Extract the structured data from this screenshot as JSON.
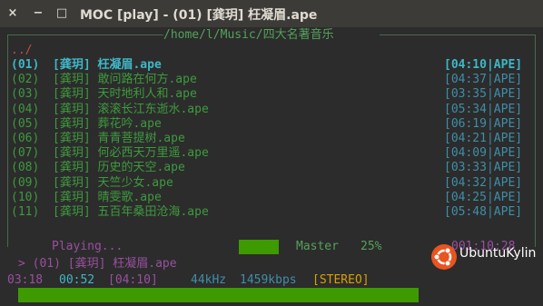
{
  "window": {
    "title": "MOC [play] - (01) [龚玥] 枉凝眉.ape",
    "close_glyph": "×",
    "minimize_glyph": "−",
    "maximize_glyph": "□"
  },
  "playlist": {
    "path": "/home/l/Music/四大名著音乐",
    "up_dir": "../",
    "tracks": [
      {
        "num": "(01)",
        "name": "[龚玥] 枉凝眉.ape",
        "time": "[04:10|APE]",
        "current": true
      },
      {
        "num": "(02)",
        "name": "[龚玥] 敢问路在何方.ape",
        "time": "[04:37|APE]"
      },
      {
        "num": "(03)",
        "name": "[龚玥] 天时地利人和.ape",
        "time": "[03:35|APE]"
      },
      {
        "num": "(04)",
        "name": "[龚玥] 滚滚长江东逝水.ape",
        "time": "[05:34|APE]"
      },
      {
        "num": "(05)",
        "name": "[龚玥] 葬花吟.ape",
        "time": "[06:19|APE]"
      },
      {
        "num": "(06)",
        "name": "[龚玥] 青青菩提树.ape",
        "time": "[04:21|APE]"
      },
      {
        "num": "(07)",
        "name": "[龚玥] 何必西天万里遥.ape",
        "time": "[04:09|APE]"
      },
      {
        "num": "(08)",
        "name": "[龚玥] 历史的天空.ape",
        "time": "[03:33|APE]"
      },
      {
        "num": "(09)",
        "name": "[龚玥] 天竺少女.ape",
        "time": "[04:32|APE]"
      },
      {
        "num": "(10)",
        "name": "[龚玥] 晴雯歌.ape",
        "time": "[04:25|APE]"
      },
      {
        "num": "(11)",
        "name": "[龚玥] 五百年桑田沧海.ape",
        "time": "[05:48|APE]"
      }
    ]
  },
  "status": {
    "state": "Playing...",
    "mixer_label": "Master",
    "volume": "25%",
    "volume_level": 0.25,
    "total_time": "001:10:28"
  },
  "now_playing": {
    "line": "> (01) [龚玥] 枉凝眉.ape",
    "elapsed": "03:18",
    "remaining": "00:52",
    "duration": "[04:10]",
    "rate": "44kHz",
    "bitrate": "1459kbps",
    "stereo": "[STEREO]",
    "progress": 0.79
  },
  "logo": {
    "text": "UbuntuKylin"
  },
  "colors": {
    "green": "#3e9a3e",
    "cyan": "#3fb7c7",
    "blue": "#3f8ea8",
    "purple": "#9a4fa0",
    "bar": "#3d9a00",
    "logo_orange": "#e95420"
  }
}
